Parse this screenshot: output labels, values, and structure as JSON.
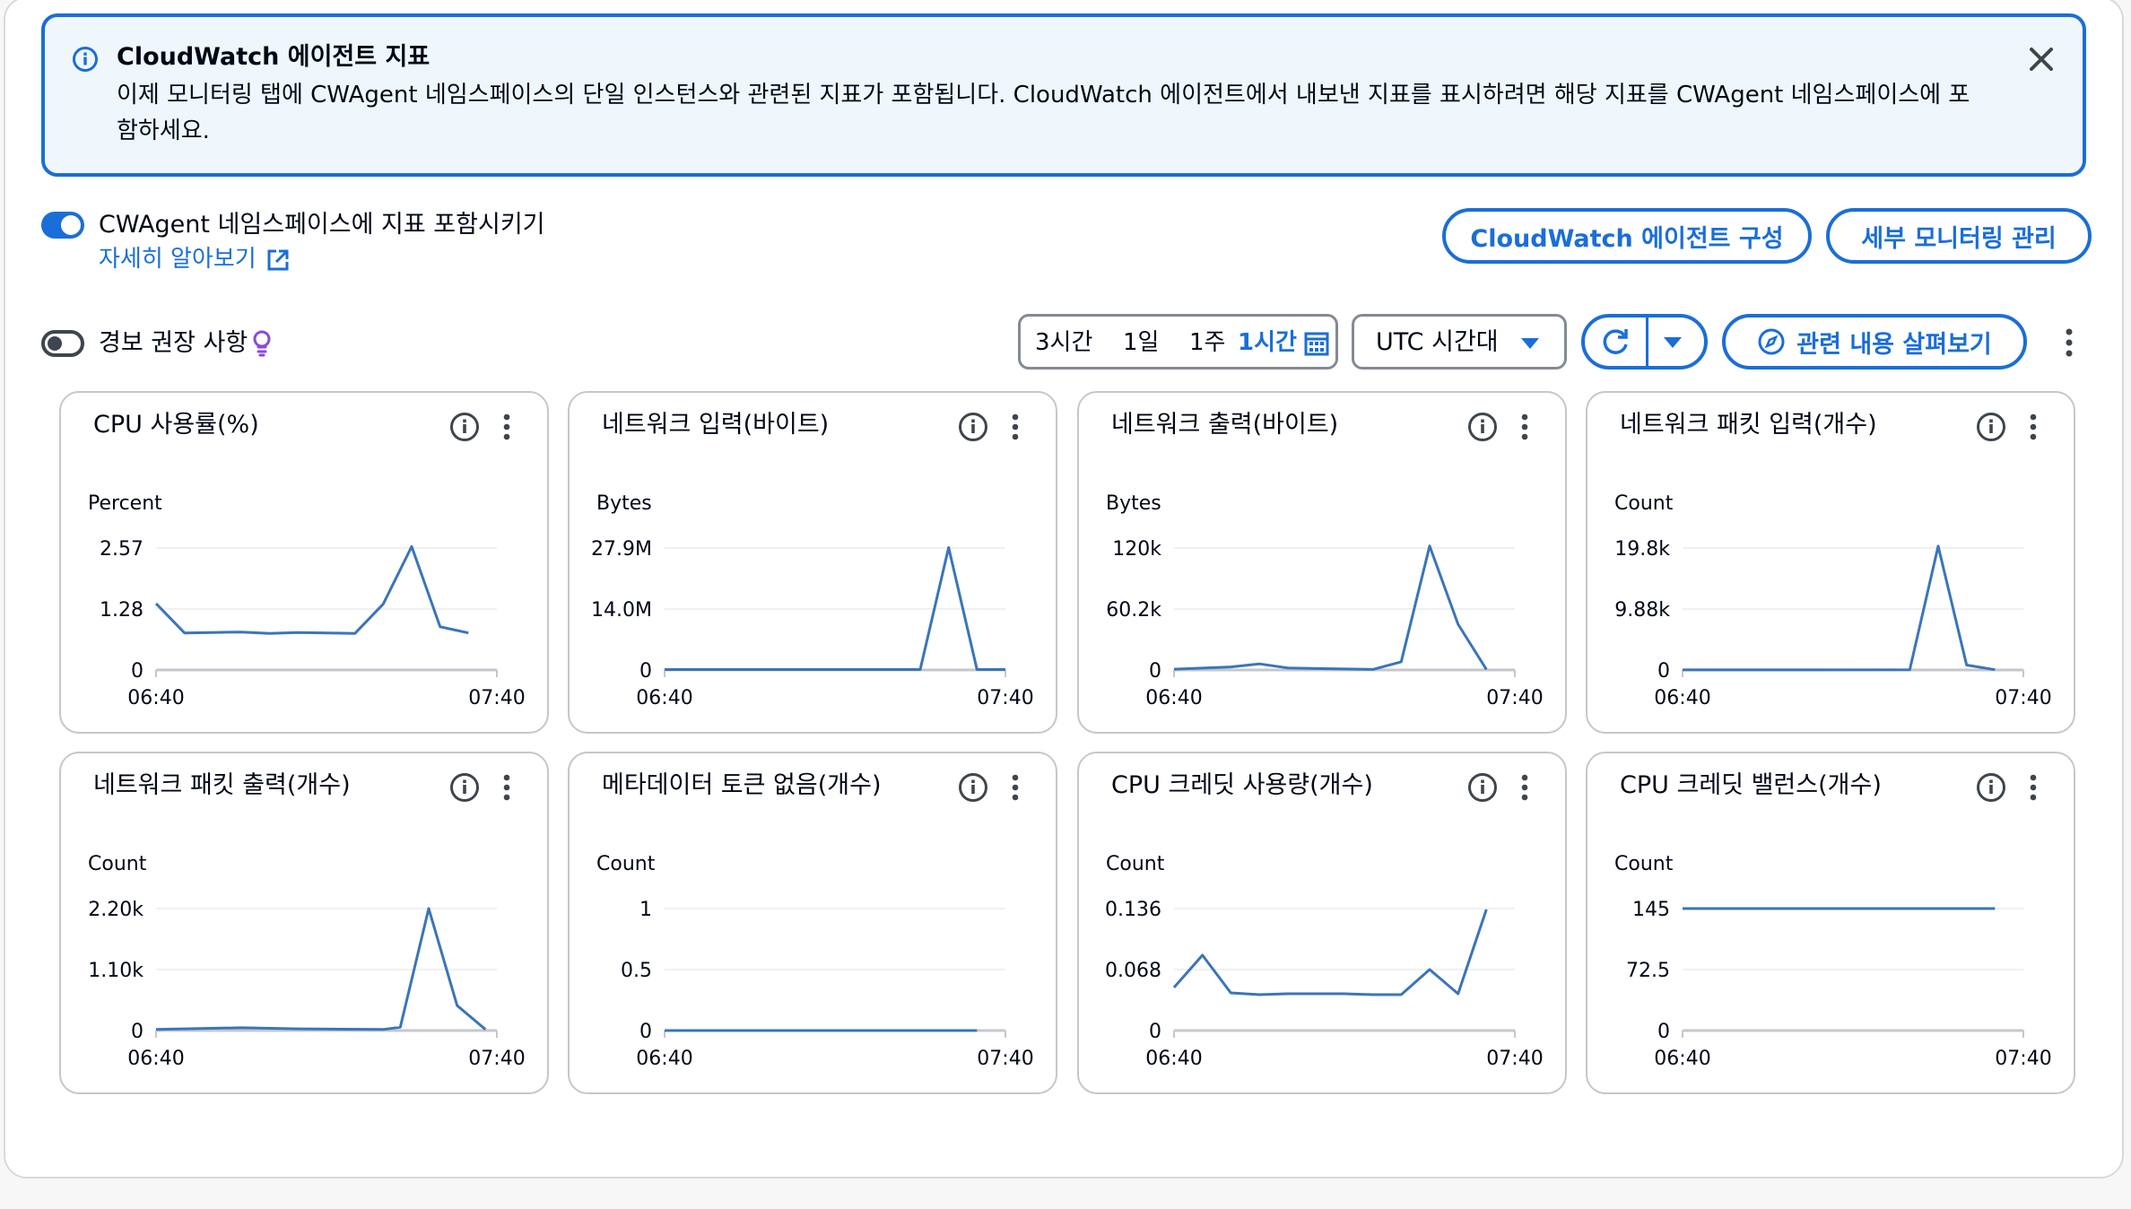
{
  "banner": {
    "title": "CloudWatch 에이전트 지표",
    "body": "이제 모니터링 탭에 CWAgent 네임스페이스의 단일 인스턴스와 관련된 지표가 포함됩니다. CloudWatch 에이전트에서 내보낸 지표를 표시하려면 해당 지표를 CWAgent 네임스페이스에 포함하세요."
  },
  "cwagent_toggle": {
    "label": "CWAgent 네임스페이스에 지표 포함시키기",
    "on": true,
    "learn_more": "자세히 알아보기"
  },
  "buttons": {
    "configure_agent": "CloudWatch 에이전트 구성",
    "manage_detailed": "세부 모니터링 관리"
  },
  "alarm_toggle": {
    "label": "경보 권장 사항",
    "on": false
  },
  "time_range": {
    "options": [
      "3시간",
      "1일",
      "1주",
      "1시간"
    ],
    "selected": "1시간"
  },
  "timezone": {
    "label": "UTC 시간대"
  },
  "explore_button": "관련 내용 살펴보기",
  "colors": {
    "accent": "#1a6ed8",
    "line": "#3a75b8",
    "axis": "#c6c6cd"
  },
  "chart_data": [
    {
      "type": "line",
      "title": "CPU 사용률(%)",
      "ylabel": "Percent",
      "ylim": [
        0,
        2.57
      ],
      "yticks": [
        "2.57",
        "1.28",
        "0"
      ],
      "xticks": [
        "06:40",
        "07:40"
      ],
      "x": [
        "06:40",
        "06:45",
        "06:50",
        "06:55",
        "07:00",
        "07:05",
        "07:10",
        "07:15",
        "07:20",
        "07:25",
        "07:30",
        "07:35"
      ],
      "values": [
        1.4,
        0.78,
        0.79,
        0.8,
        0.77,
        0.79,
        0.78,
        0.77,
        1.39,
        2.6,
        0.91,
        0.78
      ]
    },
    {
      "type": "line",
      "title": "네트워크 입력(바이트)",
      "ylabel": "Bytes",
      "ylim": [
        0,
        27.9
      ],
      "yticks": [
        "27.9M",
        "14.0M",
        "0"
      ],
      "xticks": [
        "06:40",
        "07:40"
      ],
      "x": [
        "06:40",
        "07:25",
        "07:30",
        "07:35",
        "07:40"
      ],
      "values": [
        0.1,
        0.1,
        28,
        0.1,
        0.1
      ]
    },
    {
      "type": "line",
      "title": "네트워크 출력(바이트)",
      "ylabel": "Bytes",
      "ylim": [
        0,
        120
      ],
      "yticks": [
        "120k",
        "60.2k",
        "0"
      ],
      "xticks": [
        "06:40",
        "07:40"
      ],
      "x": [
        "06:40",
        "06:50",
        "06:55",
        "07:00",
        "07:05",
        "07:15",
        "07:20",
        "07:25",
        "07:30",
        "07:35"
      ],
      "values": [
        0.8,
        3,
        6,
        2,
        1.4,
        0.5,
        8,
        122,
        45,
        0.5
      ]
    },
    {
      "type": "line",
      "title": "네트워크 패킷 입력(개수)",
      "ylabel": "Count",
      "ylim": [
        0,
        19.8
      ],
      "yticks": [
        "19.8k",
        "9.88k",
        "0"
      ],
      "xticks": [
        "06:40",
        "07:40"
      ],
      "x": [
        "06:40",
        "07:20",
        "07:25",
        "07:30",
        "07:35"
      ],
      "values": [
        0.02,
        0.03,
        20.1,
        0.8,
        0.05
      ]
    },
    {
      "type": "line",
      "title": "네트워크 패킷 출력(개수)",
      "ylabel": "Count",
      "ylim": [
        0,
        2.2
      ],
      "yticks": [
        "2.20k",
        "1.10k",
        "0"
      ],
      "xticks": [
        "06:40",
        "07:40"
      ],
      "x": [
        "06:40",
        "06:55",
        "07:05",
        "07:20",
        "07:23",
        "07:28",
        "07:33",
        "07:38"
      ],
      "values": [
        0.02,
        0.05,
        0.03,
        0.02,
        0.06,
        2.2,
        0.45,
        0.02
      ]
    },
    {
      "type": "line",
      "title": "메타데이터 토큰 없음(개수)",
      "ylabel": "Count",
      "ylim": [
        0,
        1
      ],
      "yticks": [
        "1",
        "0.5",
        "0"
      ],
      "xticks": [
        "06:40",
        "07:40"
      ],
      "x": [
        "06:40",
        "07:35"
      ],
      "values": [
        0,
        0
      ]
    },
    {
      "type": "line",
      "title": "CPU 크레딧 사용량(개수)",
      "ylabel": "Count",
      "ylim": [
        0,
        0.136
      ],
      "yticks": [
        "0.136",
        "0.068",
        "0"
      ],
      "xticks": [
        "06:40",
        "07:40"
      ],
      "x": [
        "06:40",
        "06:45",
        "06:50",
        "06:55",
        "07:00",
        "07:05",
        "07:10",
        "07:15",
        "07:20",
        "07:25",
        "07:30",
        "07:35"
      ],
      "values": [
        0.048,
        0.084,
        0.042,
        0.04,
        0.041,
        0.041,
        0.041,
        0.04,
        0.04,
        0.068,
        0.041,
        0.135
      ]
    },
    {
      "type": "line",
      "title": "CPU 크레딧 밸런스(개수)",
      "ylabel": "Count",
      "ylim": [
        0,
        145
      ],
      "yticks": [
        "145",
        "72.5",
        "0"
      ],
      "xticks": [
        "06:40",
        "07:40"
      ],
      "x": [
        "06:40",
        "07:35"
      ],
      "values": [
        145,
        145
      ]
    }
  ]
}
